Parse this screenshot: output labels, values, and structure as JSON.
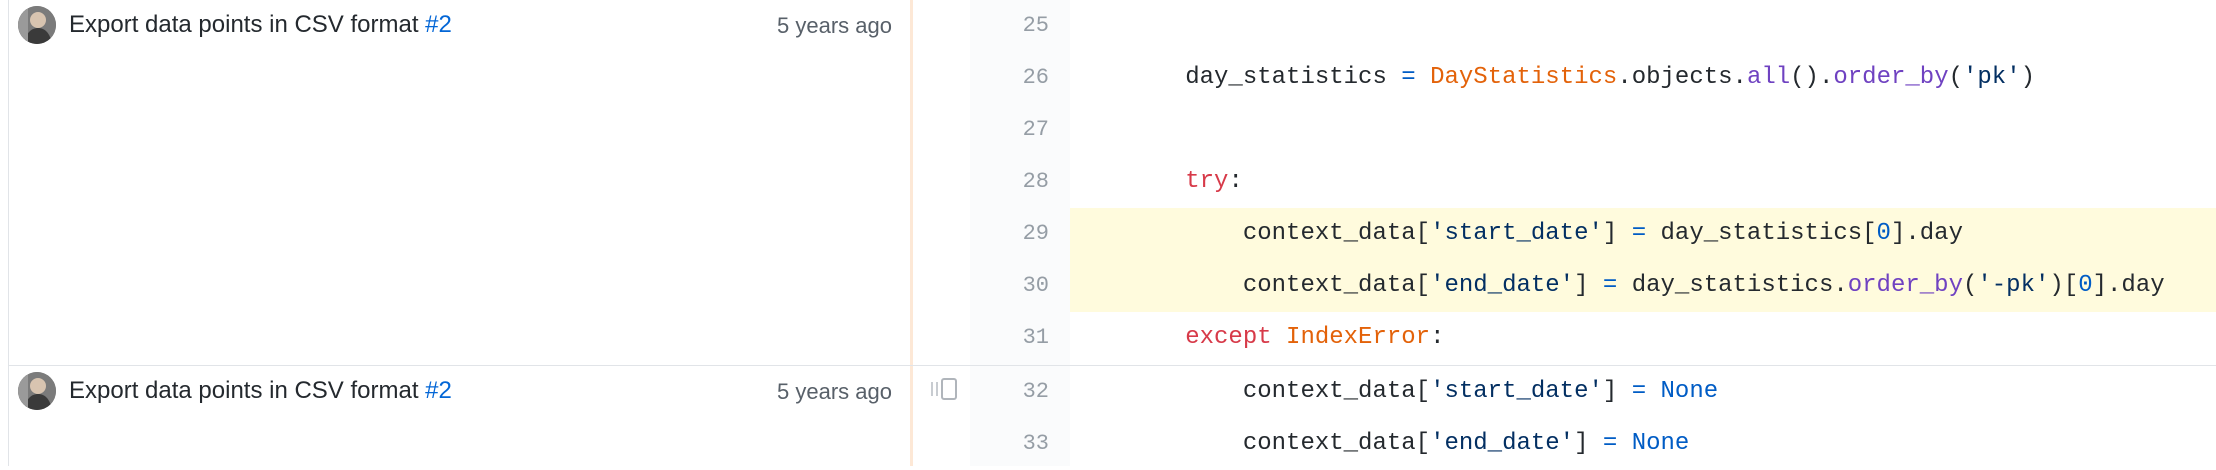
{
  "blame": [
    {
      "message": "Export data points in CSV format ",
      "pr_ref": "#2",
      "age": "5 years ago"
    },
    {
      "message": "Export data points in CSV format ",
      "pr_ref": "#2",
      "age": "5 years ago"
    }
  ],
  "lines": [
    {
      "number": "25",
      "highlighted": false,
      "tokens": []
    },
    {
      "number": "26",
      "highlighted": false,
      "tokens": [
        {
          "t": "        day_statistics ",
          "c": ""
        },
        {
          "t": "=",
          "c": "op"
        },
        {
          "t": " ",
          "c": ""
        },
        {
          "t": "DayStatistics",
          "c": "cls"
        },
        {
          "t": ".objects.",
          "c": ""
        },
        {
          "t": "all",
          "c": "fn"
        },
        {
          "t": "().",
          "c": ""
        },
        {
          "t": "order_by",
          "c": "fn"
        },
        {
          "t": "(",
          "c": ""
        },
        {
          "t": "'pk'",
          "c": "str"
        },
        {
          "t": ")",
          "c": ""
        }
      ]
    },
    {
      "number": "27",
      "highlighted": false,
      "tokens": []
    },
    {
      "number": "28",
      "highlighted": false,
      "tokens": [
        {
          "t": "        ",
          "c": ""
        },
        {
          "t": "try",
          "c": "kw"
        },
        {
          "t": ":",
          "c": ""
        }
      ]
    },
    {
      "number": "29",
      "highlighted": true,
      "tokens": [
        {
          "t": "            context_data[",
          "c": ""
        },
        {
          "t": "'start_date'",
          "c": "str"
        },
        {
          "t": "] ",
          "c": ""
        },
        {
          "t": "=",
          "c": "op"
        },
        {
          "t": " day_statistics[",
          "c": ""
        },
        {
          "t": "0",
          "c": "num-lit"
        },
        {
          "t": "].day",
          "c": ""
        }
      ]
    },
    {
      "number": "30",
      "highlighted": true,
      "tokens": [
        {
          "t": "            context_data[",
          "c": ""
        },
        {
          "t": "'end_date'",
          "c": "str"
        },
        {
          "t": "] ",
          "c": ""
        },
        {
          "t": "=",
          "c": "op"
        },
        {
          "t": " day_statistics.",
          "c": ""
        },
        {
          "t": "order_by",
          "c": "fn"
        },
        {
          "t": "(",
          "c": ""
        },
        {
          "t": "'-pk'",
          "c": "str"
        },
        {
          "t": ")[",
          "c": ""
        },
        {
          "t": "0",
          "c": "num-lit"
        },
        {
          "t": "].day",
          "c": ""
        }
      ]
    },
    {
      "number": "31",
      "highlighted": false,
      "tokens": [
        {
          "t": "        ",
          "c": ""
        },
        {
          "t": "except",
          "c": "kw"
        },
        {
          "t": " ",
          "c": ""
        },
        {
          "t": "IndexError",
          "c": "cls"
        },
        {
          "t": ":",
          "c": ""
        }
      ]
    },
    {
      "number": "32",
      "highlighted": false,
      "tokens": [
        {
          "t": "            context_data[",
          "c": ""
        },
        {
          "t": "'start_date'",
          "c": "str"
        },
        {
          "t": "] ",
          "c": ""
        },
        {
          "t": "=",
          "c": "op"
        },
        {
          "t": " ",
          "c": ""
        },
        {
          "t": "None",
          "c": "num-lit"
        }
      ]
    },
    {
      "number": "33",
      "highlighted": false,
      "tokens": [
        {
          "t": "            context_data[",
          "c": ""
        },
        {
          "t": "'end_date'",
          "c": "str"
        },
        {
          "t": "] ",
          "c": ""
        },
        {
          "t": "=",
          "c": "op"
        },
        {
          "t": " ",
          "c": ""
        },
        {
          "t": "None",
          "c": "num-lit"
        }
      ]
    }
  ],
  "colors": {
    "highlight": "#fffbdd",
    "keyword": "#d73a49",
    "class": "#e36209",
    "function": "#6f42c1",
    "string": "#032f62",
    "constant": "#005cc5",
    "link": "#0366d6"
  },
  "icons": {
    "avatar": "user-avatar",
    "reblame": "reblame-icon"
  }
}
